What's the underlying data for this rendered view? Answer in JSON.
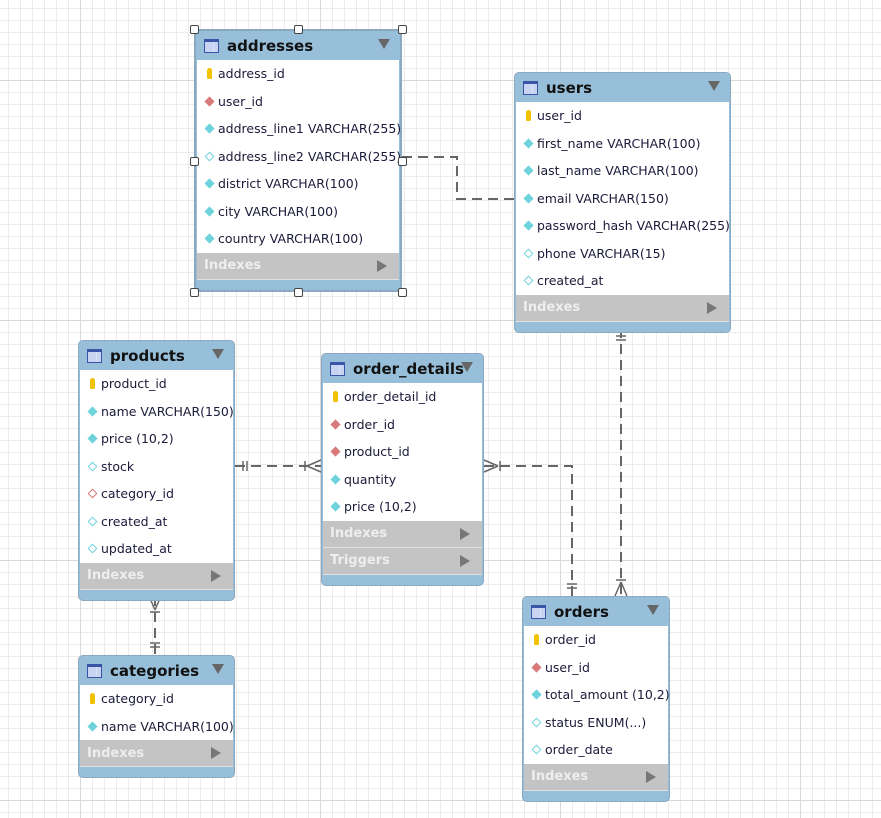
{
  "icons": {
    "table": "table-icon",
    "pk": "primary-key-icon",
    "fk": "foreign-key-icon",
    "fk_null": "foreign-key-nullable-icon",
    "nn": "not-null-column-icon",
    "null": "nullable-column-icon",
    "collapse": "collapse-triangle-icon",
    "expand": "expand-arrow-icon"
  },
  "colors": {
    "header": "#98bfda",
    "section": "#c4c4c4",
    "pk": "#f2c200",
    "fk": "#d97a7a",
    "column": "#6fd3dc",
    "line": "#666666"
  },
  "tables": [
    {
      "id": "addresses",
      "name": "addresses",
      "selected": true,
      "columns": [
        {
          "icon": "pk",
          "text": "address_id"
        },
        {
          "icon": "fk",
          "text": "user_id"
        },
        {
          "icon": "nn",
          "text": "address_line1 VARCHAR(255)"
        },
        {
          "icon": "null",
          "text": "address_line2 VARCHAR(255)"
        },
        {
          "icon": "nn",
          "text": "district VARCHAR(100)"
        },
        {
          "icon": "nn",
          "text": "city VARCHAR(100)"
        },
        {
          "icon": "nn",
          "text": "country VARCHAR(100)"
        }
      ],
      "sections": [
        "Indexes"
      ]
    },
    {
      "id": "users",
      "name": "users",
      "columns": [
        {
          "icon": "pk",
          "text": "user_id"
        },
        {
          "icon": "nn",
          "text": "first_name VARCHAR(100)"
        },
        {
          "icon": "nn",
          "text": "last_name VARCHAR(100)"
        },
        {
          "icon": "nn",
          "text": "email VARCHAR(150)"
        },
        {
          "icon": "nn",
          "text": "password_hash VARCHAR(255)"
        },
        {
          "icon": "null",
          "text": "phone VARCHAR(15)"
        },
        {
          "icon": "null",
          "text": "created_at"
        }
      ],
      "sections": [
        "Indexes"
      ]
    },
    {
      "id": "products",
      "name": "products",
      "columns": [
        {
          "icon": "pk",
          "text": "product_id"
        },
        {
          "icon": "nn",
          "text": "name VARCHAR(150)"
        },
        {
          "icon": "nn",
          "text": "price (10,2)"
        },
        {
          "icon": "null",
          "text": "stock"
        },
        {
          "icon": "fk_null",
          "text": "category_id"
        },
        {
          "icon": "null",
          "text": "created_at"
        },
        {
          "icon": "null",
          "text": "updated_at"
        }
      ],
      "sections": [
        "Indexes"
      ]
    },
    {
      "id": "order_details",
      "name": "order_details",
      "columns": [
        {
          "icon": "pk",
          "text": "order_detail_id"
        },
        {
          "icon": "fk",
          "text": "order_id"
        },
        {
          "icon": "fk",
          "text": "product_id"
        },
        {
          "icon": "nn",
          "text": "quantity"
        },
        {
          "icon": "nn",
          "text": "price (10,2)"
        }
      ],
      "sections": [
        "Indexes",
        "Triggers"
      ]
    },
    {
      "id": "categories",
      "name": "categories",
      "columns": [
        {
          "icon": "pk",
          "text": "category_id"
        },
        {
          "icon": "nn",
          "text": "name VARCHAR(100)"
        }
      ],
      "sections": [
        "Indexes"
      ]
    },
    {
      "id": "orders",
      "name": "orders",
      "columns": [
        {
          "icon": "pk",
          "text": "order_id"
        },
        {
          "icon": "fk",
          "text": "user_id"
        },
        {
          "icon": "nn",
          "text": "total_amount (10,2)"
        },
        {
          "icon": "null",
          "text": "status ENUM(...)"
        },
        {
          "icon": "null",
          "text": "order_date"
        }
      ],
      "sections": [
        "Indexes"
      ]
    }
  ],
  "relationships": [
    {
      "from": "addresses",
      "to": "users",
      "from_card": "many",
      "to_card": "one"
    },
    {
      "from": "orders",
      "to": "users",
      "from_card": "many",
      "to_card": "one"
    },
    {
      "from": "order_details",
      "to": "products",
      "from_card": "many",
      "to_card": "one"
    },
    {
      "from": "order_details",
      "to": "orders",
      "from_card": "many",
      "to_card": "one"
    },
    {
      "from": "products",
      "to": "categories",
      "from_card": "many",
      "to_card": "one"
    }
  ]
}
